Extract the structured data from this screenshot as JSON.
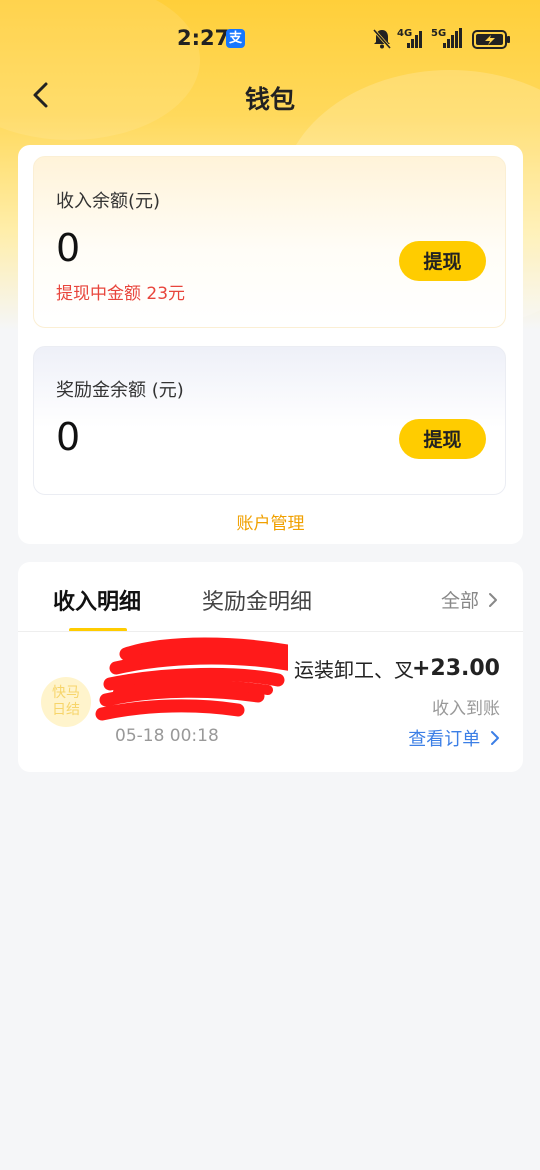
{
  "status_bar": {
    "time": "2:27",
    "app_badge": "支",
    "network_4g": "4G",
    "network_5g": "5G"
  },
  "header": {
    "title": "钱包"
  },
  "wallet": {
    "income": {
      "label": "收入余额(元)",
      "amount": "0",
      "pending": "提现中金额 23元",
      "withdraw_label": "提现"
    },
    "bonus": {
      "label": "奖励金余额 (元)",
      "amount": "0",
      "withdraw_label": "提现"
    },
    "account_link": "账户管理"
  },
  "details": {
    "tabs": [
      {
        "label": "收入明细",
        "active": true
      },
      {
        "label": "奖励金明细",
        "active": false
      }
    ],
    "filter_label": "全部",
    "items": [
      {
        "logo_line1": "快马",
        "logo_line2": "日结",
        "title": "运装卸工、叉",
        "date": "05-18 00:18",
        "amount": "+23.00",
        "status": "收入到账",
        "link": "查看订单"
      }
    ]
  },
  "colors": {
    "accent": "#ffcc00",
    "alert_red": "#e8453c",
    "link_blue": "#3c7fe6",
    "link_orange": "#f0a000"
  }
}
